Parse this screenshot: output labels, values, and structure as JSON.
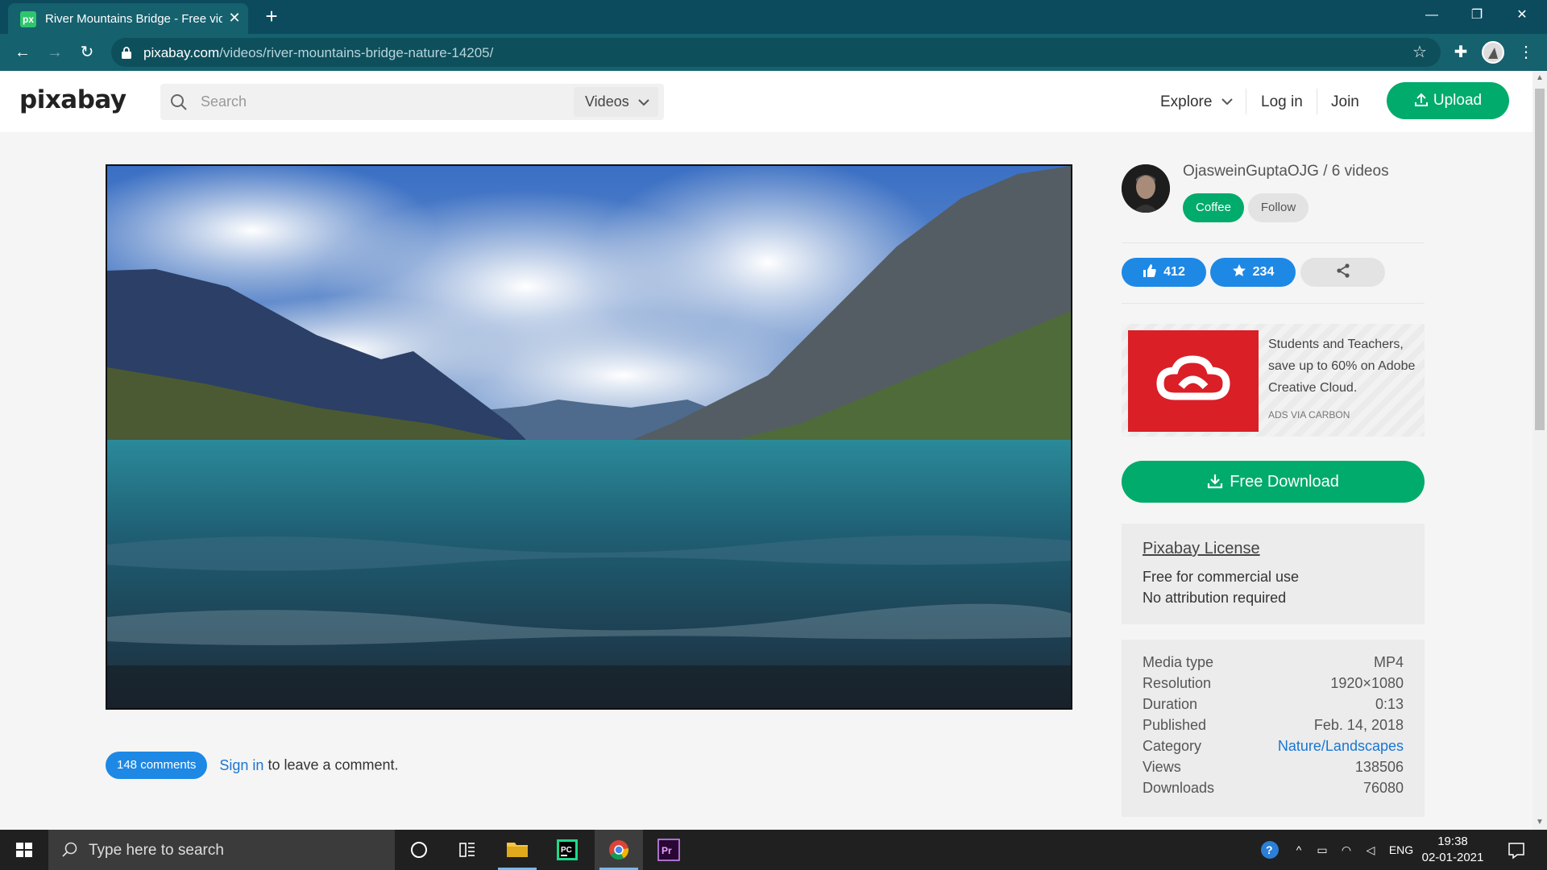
{
  "browser": {
    "tab_title": "River Mountains Bridge - Free vid",
    "tab_favicon": "px",
    "url_host": "pixabay.com",
    "url_path": "/videos/river-mountains-bridge-nature-14205/"
  },
  "header": {
    "logo": "pixabay",
    "search_placeholder": "Search",
    "search_type": "Videos",
    "explore": "Explore",
    "login": "Log in",
    "join": "Join",
    "upload": "Upload"
  },
  "author": {
    "name_line": "OjasweinGuptaOJG / 6 videos",
    "coffee": "Coffee",
    "follow": "Follow"
  },
  "stats": {
    "likes": "412",
    "favorites": "234"
  },
  "ad": {
    "text": "Students and Teachers, save up to 60% on Adobe Creative Cloud.",
    "via": "ADS VIA CARBON"
  },
  "download": {
    "label": "Free Download"
  },
  "license": {
    "title": "Pixabay License",
    "line1": "Free for commercial use",
    "line2": "No attribution required"
  },
  "info": {
    "rows": [
      {
        "label": "Media type",
        "value": "MP4"
      },
      {
        "label": "Resolution",
        "value": "1920×1080"
      },
      {
        "label": "Duration",
        "value": "0:13"
      },
      {
        "label": "Published",
        "value": "Feb. 14, 2018"
      },
      {
        "label": "Category",
        "value": "Nature/Landscapes"
      },
      {
        "label": "Views",
        "value": "138506"
      },
      {
        "label": "Downloads",
        "value": "76080"
      }
    ]
  },
  "comments": {
    "count_label": "148 comments",
    "signin": "Sign in",
    "suffix": " to leave a comment."
  },
  "taskbar": {
    "search_text": "Type here to search",
    "language": "ENG",
    "time": "19:38",
    "date": "02-01-2021"
  },
  "colors": {
    "brand_green": "#00ab6b",
    "accent_blue": "#1e88e5",
    "chrome_teal": "#15616e",
    "adobe_red": "#da1f26"
  }
}
